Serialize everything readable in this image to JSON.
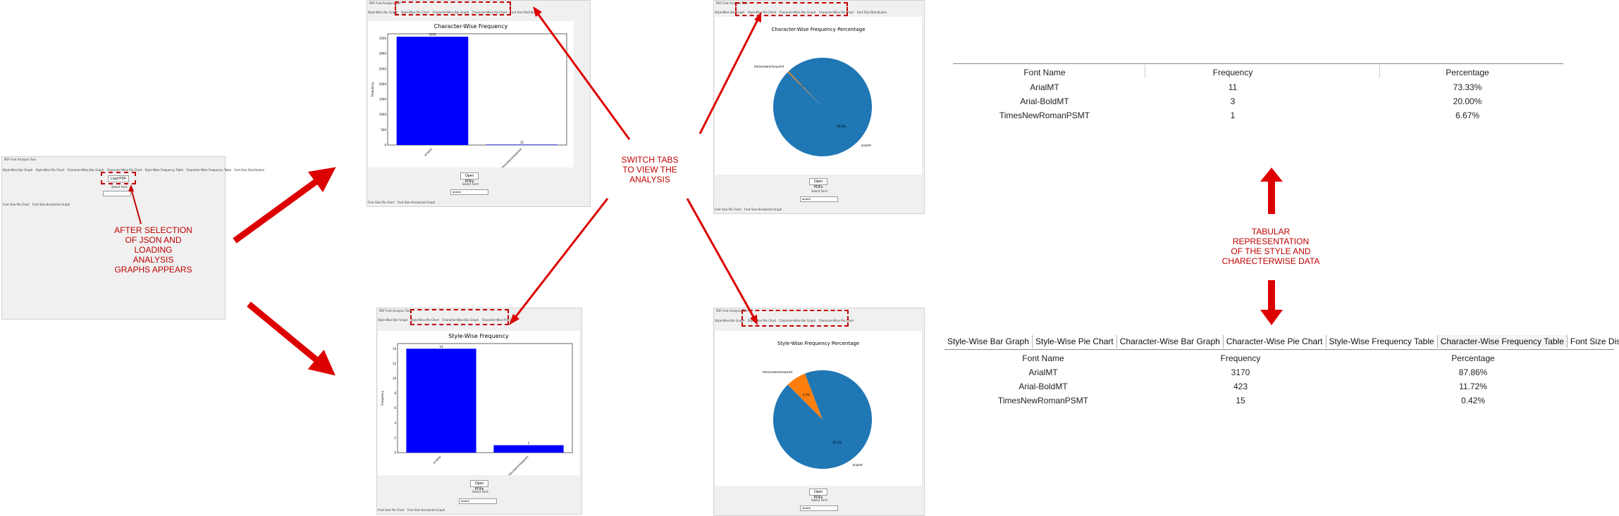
{
  "app": {
    "window_title": "PDF Font Analysis Tool",
    "tabs": [
      "Style-Wise Bar Graph",
      "Style-Wise Pie Chart",
      "Character-Wise Bar Graph",
      "Character-Wise Pie Chart",
      "Style-Wise Frequency Table",
      "Character-Wise Frequency Table",
      "Font Size Distribution"
    ],
    "tabs_short_second_row": [
      "Font Size Pie Chart",
      "Font Size Horizontal Graph"
    ],
    "load_pdf_label": "Load PDF",
    "open_pdfs_label": "Open PDFs",
    "select_font_label": "Select Font:",
    "select_font_value": "arialmt"
  },
  "annotations": {
    "after_selection": "AFTER SELECTION\nOF JSON AND\nLOADING\nANALYSIS\nGRAPHS APPEARS",
    "switch_tabs": "SWITCH TABS\nTO VIEW THE\nANALYSIS",
    "tabular": "TABULAR\nREPRESENTATION\nOF  THE STYLE AND\nCHARECTERWISE DATA"
  },
  "char_bar": {
    "title": "Character-Wise Frequency",
    "ylabel": "Frequency",
    "categories": [
      "arialmt",
      "timesnewromanpsmt"
    ],
    "values": [
      3553,
      15
    ],
    "value_labels": [
      "3553",
      "15"
    ],
    "yticks": [
      "0",
      "500",
      "1000",
      "1500",
      "2000",
      "2500",
      "3000",
      "3500"
    ],
    "color": "#0000ff"
  },
  "style_bar": {
    "title": "Style-Wise Frequency",
    "ylabel": "Frequency",
    "categories": [
      "arialmt",
      "timesnewromanpsmt"
    ],
    "values": [
      14,
      1
    ],
    "value_labels": [
      "14",
      "1"
    ],
    "yticks": [
      "0",
      "2",
      "4",
      "6",
      "8",
      "10",
      "12",
      "14"
    ],
    "color": "#0000ff"
  },
  "char_pie": {
    "title": "Character-Wise Frequency Percentage",
    "labels": [
      "timesnewromanpsmt",
      "arialmt"
    ],
    "pct_labels": [
      "0.4%",
      "99.6%"
    ],
    "values": [
      0.4,
      99.6
    ],
    "colors": [
      "#ff7f0e",
      "#1f77b4"
    ]
  },
  "style_pie": {
    "title": "Style-Wise Frequency Percentage",
    "labels": [
      "timesnewromanpsmt",
      "arialmt"
    ],
    "pct_labels": [
      "6.7%",
      "93.3%"
    ],
    "values": [
      6.7,
      93.3
    ],
    "colors": [
      "#ff7f0e",
      "#1f77b4"
    ]
  },
  "style_table": {
    "headers": [
      "Font Name",
      "Frequency",
      "Percentage"
    ],
    "rows": [
      [
        "ArialMT",
        "11",
        "73.33%"
      ],
      [
        "Arial-BoldMT",
        "3",
        "20.00%"
      ],
      [
        "TimesNewRomanPSMT",
        "1",
        "6.67%"
      ]
    ]
  },
  "char_table": {
    "tabs": [
      "Style-Wise Bar Graph",
      "Style-Wise Pie Chart",
      "Character-Wise Bar Graph",
      "Character-Wise Pie Chart",
      "Style-Wise Frequency Table",
      "Character-Wise Frequency Table",
      "Font Size Distributi"
    ],
    "headers": [
      "Font Name",
      "Frequency",
      "Percentage"
    ],
    "rows": [
      [
        "ArialMT",
        "3170",
        "87.86%"
      ],
      [
        "Arial-BoldMT",
        "423",
        "11.72%"
      ],
      [
        "TimesNewRomanPSMT",
        "15",
        "0.42%"
      ]
    ]
  },
  "colors": {
    "accent_red": "#c00000",
    "arrow_red": "#dd0000",
    "bar_blue": "#0000ff"
  }
}
